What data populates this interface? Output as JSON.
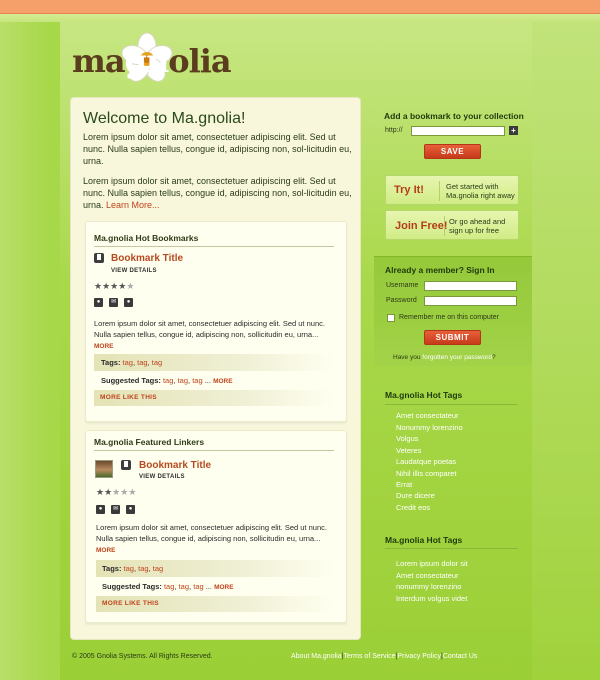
{
  "brand": {
    "logo_text_a": "ma",
    "logo_text_b": "gn",
    "logo_text_c": "olia"
  },
  "colors": {
    "accent_red": "#c0441c",
    "top_bar": "#f59f6b",
    "background_green": "#9ed23e",
    "card_cream": "#f8f7dc"
  },
  "welcome": {
    "title": "Welcome to Ma.gnolia!",
    "para1": "Lorem ipsum dolor sit amet, consectetuer adipiscing elit. Sed ut nunc. Nulla sapien tellus, congue id, adipiscing non, sol-licitudin eu, urna.",
    "para2": "Lorem ipsum dolor sit amet, consectetuer adipiscing elit. Sed ut nunc. Nulla sapien tellus, congue id, adipiscing non, sol-licitudin eu, urna.",
    "learn_more": "Learn More..."
  },
  "hot_bookmarks": {
    "section_title": "Ma.gnolia Hot Bookmarks",
    "bookmark_title": "Bookmark Title",
    "view_details": "VIEW DETAILS",
    "rating": 4,
    "rating_max": 5,
    "description": "Lorem ipsum dolor sit amet, consectetuer adipiscing elit. Sed ut nunc. Nulla sapien tellus, congue id, adipiscing non, sollicitudin eu, urna...",
    "more": "MORE",
    "tags_label": "Tags:",
    "tags": [
      "tag",
      "tag",
      "tag"
    ],
    "suggested_label": "Suggested Tags:",
    "suggested": [
      "tag",
      "tag",
      "tag"
    ],
    "suggested_ellipsis": "...",
    "suggested_more": "MORE",
    "more_like_this": "MORE LIKE THIS"
  },
  "featured_linkers": {
    "section_title": "Ma.gnolia Featured Linkers",
    "bookmark_title": "Bookmark Title",
    "view_details": "VIEW DETAILS",
    "rating": 2,
    "rating_max": 5,
    "description": "Lorem ipsum dolor sit amet, consectetuer adipiscing elit. Sed ut nunc. Nulla sapien tellus, congue id, adipiscing non, sollicitudin eu, urna...",
    "more": "MORE",
    "tags_label": "Tags:",
    "tags": [
      "tag",
      "tag",
      "tag"
    ],
    "suggested_label": "Suggested Tags:",
    "suggested": [
      "tag",
      "tag",
      "tag"
    ],
    "suggested_ellipsis": "...",
    "suggested_more": "MORE",
    "more_like_this": "MORE LIKE THIS"
  },
  "add_bookmark": {
    "heading": "Add a bookmark to your collection",
    "url_label": "http://",
    "url_value": "",
    "plus": "+",
    "save": "SAVE"
  },
  "cta_try": {
    "big": "Try It!",
    "line1": "Get started with",
    "line2": "Ma.gnolia right away"
  },
  "cta_join": {
    "big": "Join Free!",
    "line1": "Or go ahead and",
    "line2": "sign up for free"
  },
  "login": {
    "heading": "Already a member? Sign In",
    "username_label": "Username",
    "username_value": "",
    "password_label": "Password",
    "password_value": "",
    "remember_label": "Remember me on this computer",
    "submit": "SUBMIT",
    "forgot_prefix": "Have you",
    "forgot_link": "forgotten your password",
    "forgot_suffix": "?"
  },
  "hot_tags_1": {
    "heading": "Ma.gnolia Hot Tags",
    "items": [
      "Amet consectateur",
      "Nonummy lorenzino",
      "Volgus",
      "Veteres",
      "Laudatque poetas",
      "Nihil illis comparet",
      "Errat",
      "Dure dicere",
      "Credit eos"
    ]
  },
  "hot_tags_2": {
    "heading": "Ma.gnolia Hot Tags",
    "items": [
      "Lorem ipsum dolor sit",
      "Amet consectateur",
      "nonummy lorenzino",
      "Interdum volgus videt"
    ]
  },
  "footer": {
    "copyright": "© 2005 Gnolia Systems. All Rights Reserved.",
    "links": [
      "About Ma.gnolia",
      "Terms of Service",
      "Privacy Policy",
      "Contact Us"
    ],
    "separator": "|"
  }
}
